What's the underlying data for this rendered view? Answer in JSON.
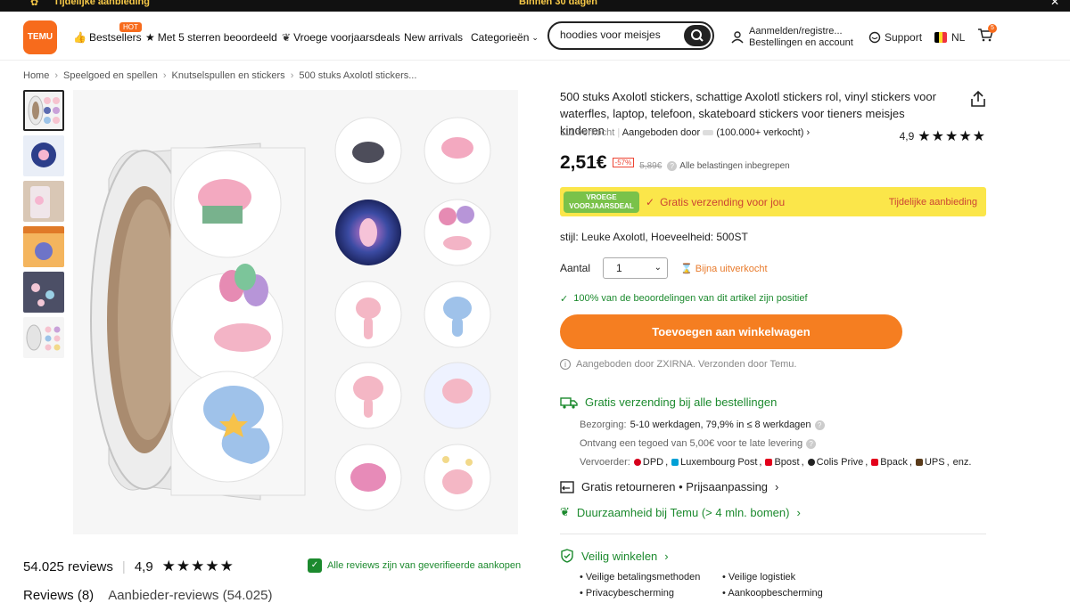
{
  "topbar": {
    "left": "Tijdelijke aanbieding",
    "center": "Binnen 30 dagen"
  },
  "header": {
    "logo": "TEMU",
    "hot_badge": "HOT",
    "nav": [
      "Bestsellers",
      "Met 5 sterren beoordeeld",
      "Vroege voorjaarsdeals",
      "New arrivals",
      "Categorieën"
    ],
    "search_value": "hoodies voor meisjes",
    "account_line1": "Aanmelden/registre...",
    "account_line2": "Bestellingen en account",
    "support": "Support",
    "lang": "NL",
    "cart_count": "5"
  },
  "breadcrumb": [
    "Home",
    "Speelgoed en spellen",
    "Knutselspullen en stickers",
    "500 stuks Axolotl stickers..."
  ],
  "product": {
    "title": "500 stuks Axolotl stickers, schattige Axolotl stickers rol, vinyl stickers voor waterfles, laptop, telefoon, skateboard stickers voor tieners meisjes kinderen",
    "sold": "111 verkocht",
    "offered_by": "Aangeboden door",
    "seller_sold": "(100.000+ verkocht)",
    "rating": "4,9",
    "price": "2,51€",
    "discount": "-57%",
    "old_price": "5,89€",
    "vat": "Alle belastingen inbegrepen",
    "promo_badge_line1": "VROEGE",
    "promo_badge_line2": "VOORJAARSDEAL",
    "promo_free": "Gratis verzending voor jou",
    "promo_deal": "Tijdelijke aanbieding",
    "style": "stijl: Leuke Axolotl, Hoeveelheid: 500ST",
    "qty_label": "Aantal",
    "qty_value": "1",
    "low_stock": "Bijna uitverkocht",
    "positive": "100% van de beoordelingen van dit artikel zijn positief",
    "add_to_cart": "Toevoegen aan winkelwagen",
    "shipped_by": "Aangeboden door ZXIRNA. Verzonden door Temu."
  },
  "shipping": {
    "head": "Gratis verzending bij alle bestellingen",
    "delivery_label": "Bezorging:",
    "delivery_value": "5-10 werkdagen, 79,9% in ≤ 8 werkdagen",
    "credit": "Ontvang een tegoed van 5,00€ voor te late levering",
    "carrier_label": "Vervoerder:",
    "carriers": [
      "DPD",
      "Luxembourg Post",
      "Bpost",
      "Colis Prive",
      "Bpack",
      "UPS",
      "enz."
    ],
    "returns": "Gratis retourneren • Prijsaanpassing",
    "sustain": "Duurzaamheid bij Temu (> 4 mln. bomen)",
    "safe": "Veilig winkelen",
    "safe_items": [
      "Veilige betalingsmethoden",
      "Veilige logistiek",
      "Privacybescherming",
      "Aankoopbescherming"
    ]
  },
  "reviews": {
    "count": "54.025 reviews",
    "rating": "4,9",
    "verified": "Alle reviews zijn van geverifieerde aankopen",
    "tab_active": "Reviews (8)",
    "tab_other": "Aanbieder-reviews (54.025)"
  },
  "colors": {
    "brand": "#f76b1c",
    "green": "#1c8a2e",
    "promo": "#fbe64a",
    "cta": "#f57e21"
  }
}
